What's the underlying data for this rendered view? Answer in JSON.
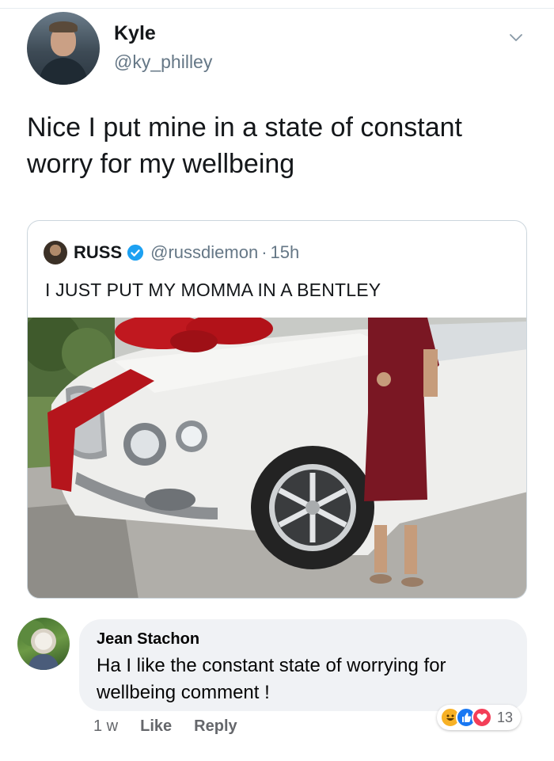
{
  "tweet": {
    "author_name": "Kyle",
    "author_handle": "@ky_philley",
    "text": "Nice I put mine in a state of constant worry for my wellbeing"
  },
  "quoted_tweet": {
    "author_name": "RUSS",
    "author_handle": "@russdiemon",
    "separator": "·",
    "time": "15h",
    "text": "I JUST PUT MY MOMMA IN A BENTLEY",
    "verified_color": "#1da1f2"
  },
  "comment": {
    "author_name": "Jean Stachon",
    "text": "Ha  I like the constant state of worrying for wellbeing comment !",
    "time": "1 w",
    "like_label": "Like",
    "reply_label": "Reply",
    "reaction_count": "13",
    "reactions": [
      "haha",
      "like",
      "love"
    ]
  },
  "icons": {
    "chevron": "chevron-down-icon",
    "verified": "verified-badge-icon"
  }
}
